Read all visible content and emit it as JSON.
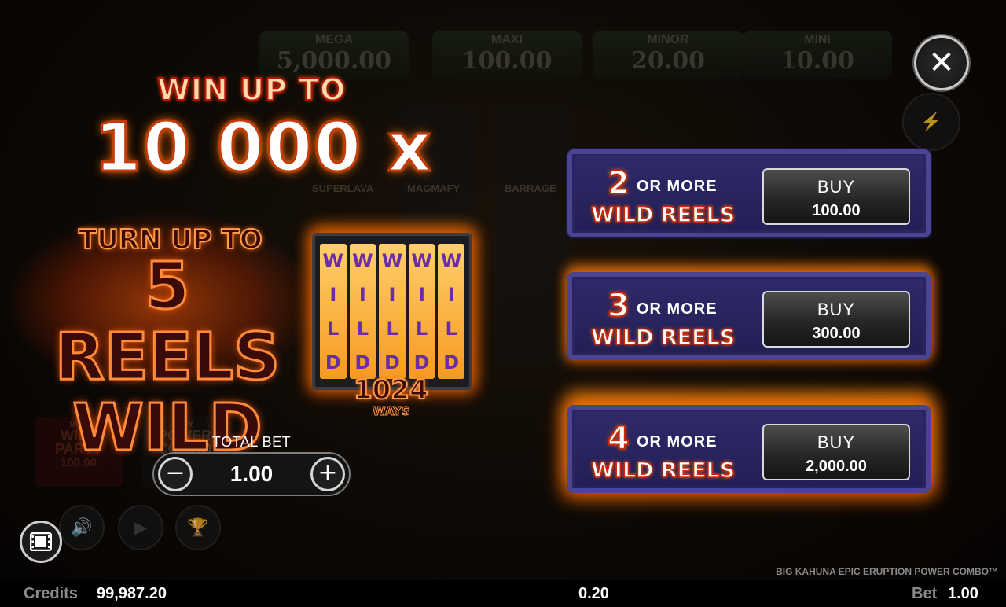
{
  "background": {
    "jackpots": [
      {
        "name": "MEGA",
        "value": "5,000.00"
      },
      {
        "name": "MAXI",
        "value": "100.00"
      },
      {
        "name": "MINOR",
        "value": "20.00"
      },
      {
        "name": "MINI",
        "value": "10.00"
      }
    ],
    "features": [
      "SUPERLAVA",
      "MAGMAFY",
      "BARRAGE"
    ],
    "buy_wild_party": {
      "line1": "BUY",
      "line2": "WILD",
      "line3": "PARTY",
      "price": "100.00"
    },
    "buy_power_combo": {
      "line1": "BUY",
      "line2": "POWER",
      "line3": "COMBO"
    }
  },
  "promo": {
    "win_up_to": "WIN UP TO",
    "multiplier": "10 000 x",
    "turn_up_to": "TURN UP TO",
    "reels_wild_line1": "5 REELS",
    "reels_wild_line2": "WILD",
    "reel_letters": [
      "W",
      "I",
      "L",
      "D"
    ],
    "ways_number": "1024",
    "ways_label": "WAYS"
  },
  "total_bet": {
    "label": "TOTAL BET",
    "value": "1.00",
    "minus_label": "−",
    "plus_label": "+"
  },
  "buy_options": [
    {
      "count": "2",
      "or_more": "OR MORE",
      "wild_reels": "WILD REELS",
      "buy_label": "BUY",
      "price": "100.00"
    },
    {
      "count": "3",
      "or_more": "OR MORE",
      "wild_reels": "WILD REELS",
      "buy_label": "BUY",
      "price": "300.00"
    },
    {
      "count": "4",
      "or_more": "OR MORE",
      "wild_reels": "WILD REELS",
      "buy_label": "BUY",
      "price": "2,000.00"
    }
  ],
  "close_label": "✕",
  "game_name": "BIG KAHUNA EPIC ERUPTION POWER COMBO™",
  "footer": {
    "credits_label": "Credits",
    "credits_value": "99,987.20",
    "win_value": "0.20",
    "bet_label": "Bet",
    "bet_value": "1.00"
  },
  "colors": {
    "panel_bg": "#2f2a6a",
    "fire_orange": "#ff6a00",
    "text_red_stroke": "#c62a0a"
  }
}
